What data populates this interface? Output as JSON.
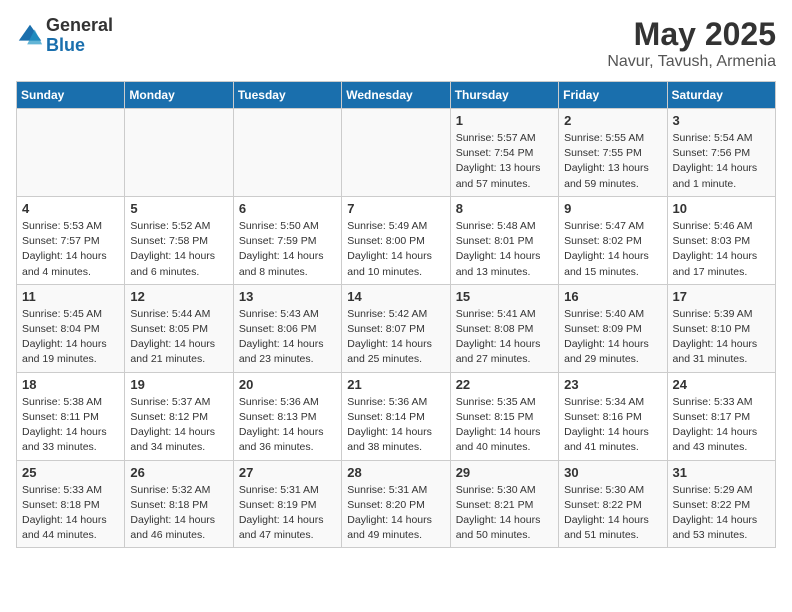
{
  "logo": {
    "general": "General",
    "blue": "Blue"
  },
  "title": "May 2025",
  "subtitle": "Navur, Tavush, Armenia",
  "weekdays": [
    "Sunday",
    "Monday",
    "Tuesday",
    "Wednesday",
    "Thursday",
    "Friday",
    "Saturday"
  ],
  "rows": [
    [
      {
        "day": "",
        "info": ""
      },
      {
        "day": "",
        "info": ""
      },
      {
        "day": "",
        "info": ""
      },
      {
        "day": "",
        "info": ""
      },
      {
        "day": "1",
        "info": "Sunrise: 5:57 AM\nSunset: 7:54 PM\nDaylight: 13 hours\nand 57 minutes."
      },
      {
        "day": "2",
        "info": "Sunrise: 5:55 AM\nSunset: 7:55 PM\nDaylight: 13 hours\nand 59 minutes."
      },
      {
        "day": "3",
        "info": "Sunrise: 5:54 AM\nSunset: 7:56 PM\nDaylight: 14 hours\nand 1 minute."
      }
    ],
    [
      {
        "day": "4",
        "info": "Sunrise: 5:53 AM\nSunset: 7:57 PM\nDaylight: 14 hours\nand 4 minutes."
      },
      {
        "day": "5",
        "info": "Sunrise: 5:52 AM\nSunset: 7:58 PM\nDaylight: 14 hours\nand 6 minutes."
      },
      {
        "day": "6",
        "info": "Sunrise: 5:50 AM\nSunset: 7:59 PM\nDaylight: 14 hours\nand 8 minutes."
      },
      {
        "day": "7",
        "info": "Sunrise: 5:49 AM\nSunset: 8:00 PM\nDaylight: 14 hours\nand 10 minutes."
      },
      {
        "day": "8",
        "info": "Sunrise: 5:48 AM\nSunset: 8:01 PM\nDaylight: 14 hours\nand 13 minutes."
      },
      {
        "day": "9",
        "info": "Sunrise: 5:47 AM\nSunset: 8:02 PM\nDaylight: 14 hours\nand 15 minutes."
      },
      {
        "day": "10",
        "info": "Sunrise: 5:46 AM\nSunset: 8:03 PM\nDaylight: 14 hours\nand 17 minutes."
      }
    ],
    [
      {
        "day": "11",
        "info": "Sunrise: 5:45 AM\nSunset: 8:04 PM\nDaylight: 14 hours\nand 19 minutes."
      },
      {
        "day": "12",
        "info": "Sunrise: 5:44 AM\nSunset: 8:05 PM\nDaylight: 14 hours\nand 21 minutes."
      },
      {
        "day": "13",
        "info": "Sunrise: 5:43 AM\nSunset: 8:06 PM\nDaylight: 14 hours\nand 23 minutes."
      },
      {
        "day": "14",
        "info": "Sunrise: 5:42 AM\nSunset: 8:07 PM\nDaylight: 14 hours\nand 25 minutes."
      },
      {
        "day": "15",
        "info": "Sunrise: 5:41 AM\nSunset: 8:08 PM\nDaylight: 14 hours\nand 27 minutes."
      },
      {
        "day": "16",
        "info": "Sunrise: 5:40 AM\nSunset: 8:09 PM\nDaylight: 14 hours\nand 29 minutes."
      },
      {
        "day": "17",
        "info": "Sunrise: 5:39 AM\nSunset: 8:10 PM\nDaylight: 14 hours\nand 31 minutes."
      }
    ],
    [
      {
        "day": "18",
        "info": "Sunrise: 5:38 AM\nSunset: 8:11 PM\nDaylight: 14 hours\nand 33 minutes."
      },
      {
        "day": "19",
        "info": "Sunrise: 5:37 AM\nSunset: 8:12 PM\nDaylight: 14 hours\nand 34 minutes."
      },
      {
        "day": "20",
        "info": "Sunrise: 5:36 AM\nSunset: 8:13 PM\nDaylight: 14 hours\nand 36 minutes."
      },
      {
        "day": "21",
        "info": "Sunrise: 5:36 AM\nSunset: 8:14 PM\nDaylight: 14 hours\nand 38 minutes."
      },
      {
        "day": "22",
        "info": "Sunrise: 5:35 AM\nSunset: 8:15 PM\nDaylight: 14 hours\nand 40 minutes."
      },
      {
        "day": "23",
        "info": "Sunrise: 5:34 AM\nSunset: 8:16 PM\nDaylight: 14 hours\nand 41 minutes."
      },
      {
        "day": "24",
        "info": "Sunrise: 5:33 AM\nSunset: 8:17 PM\nDaylight: 14 hours\nand 43 minutes."
      }
    ],
    [
      {
        "day": "25",
        "info": "Sunrise: 5:33 AM\nSunset: 8:18 PM\nDaylight: 14 hours\nand 44 minutes."
      },
      {
        "day": "26",
        "info": "Sunrise: 5:32 AM\nSunset: 8:18 PM\nDaylight: 14 hours\nand 46 minutes."
      },
      {
        "day": "27",
        "info": "Sunrise: 5:31 AM\nSunset: 8:19 PM\nDaylight: 14 hours\nand 47 minutes."
      },
      {
        "day": "28",
        "info": "Sunrise: 5:31 AM\nSunset: 8:20 PM\nDaylight: 14 hours\nand 49 minutes."
      },
      {
        "day": "29",
        "info": "Sunrise: 5:30 AM\nSunset: 8:21 PM\nDaylight: 14 hours\nand 50 minutes."
      },
      {
        "day": "30",
        "info": "Sunrise: 5:30 AM\nSunset: 8:22 PM\nDaylight: 14 hours\nand 51 minutes."
      },
      {
        "day": "31",
        "info": "Sunrise: 5:29 AM\nSunset: 8:22 PM\nDaylight: 14 hours\nand 53 minutes."
      }
    ]
  ]
}
